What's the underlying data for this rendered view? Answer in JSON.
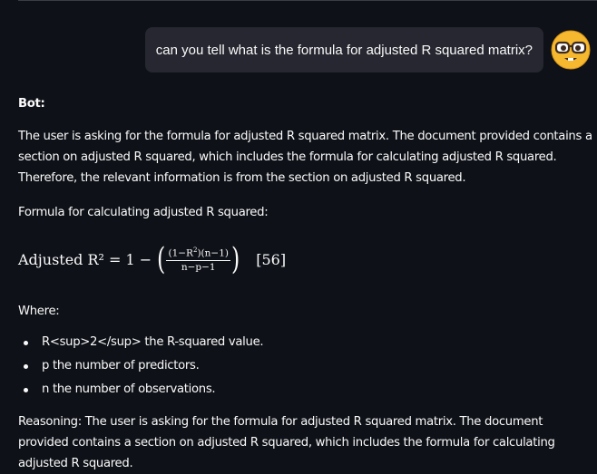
{
  "user_message": {
    "text": "can you tell what is the formula for adjusted R squared matrix?",
    "avatar_icon": "nerd-face-emoji-icon"
  },
  "bot": {
    "label": "Bot:",
    "intro": "The user is asking for the formula for adjusted R squared matrix. The document provided contains a section on adjusted R squared, which includes the formula for calculating adjusted R squared. Therefore, the relevant information is from the section on adjusted R squared.",
    "formula_heading": "Formula for calculating adjusted R squared:",
    "formula": {
      "lhs": "Adjusted R² = 1 −",
      "numerator_pre": "(1−R",
      "numerator_sup": "2",
      "numerator_post": ")(n−1)",
      "denominator": "n−p−1",
      "reference": "[56]"
    },
    "where_label": "Where:",
    "bullets": [
      "R<sup>2</sup> the R-squared value.",
      "p the number of predictors.",
      "n the number of observations."
    ],
    "reasoning": "Reasoning: The user is asking for the formula for adjusted R squared matrix. The document provided contains a section on adjusted R squared, which includes the formula for calculating adjusted R squared."
  },
  "colors": {
    "background": "#0e1117",
    "user_bubble": "#262730",
    "text": "#fafafa",
    "avatar": "#f5b82e"
  }
}
